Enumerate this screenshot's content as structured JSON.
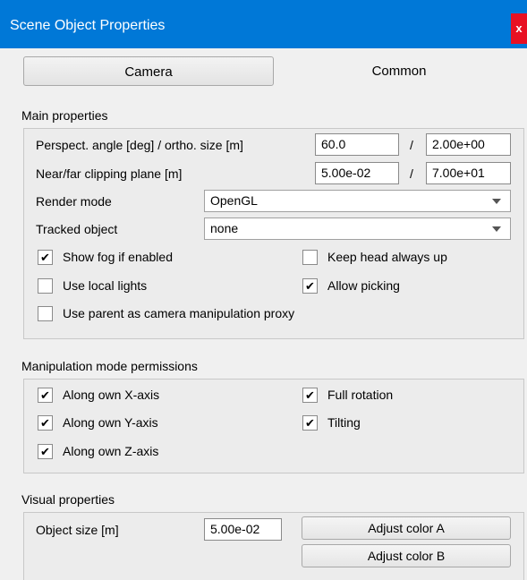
{
  "window": {
    "title": "Scene Object Properties",
    "close_label": "x"
  },
  "tabs": [
    {
      "label": "Camera",
      "active": true
    },
    {
      "label": "Common",
      "active": false
    }
  ],
  "main": {
    "section_label": "Main properties",
    "perspective": {
      "label": "Perspect. angle [deg] / ortho. size [m]",
      "value1": "60.0",
      "separator": "/",
      "value2": "2.00e+00"
    },
    "clipping": {
      "label": "Near/far clipping plane [m]",
      "value1": "5.00e-02",
      "separator": "/",
      "value2": "7.00e+01"
    },
    "render_mode": {
      "label": "Render mode",
      "value": "OpenGL"
    },
    "tracked_object": {
      "label": "Tracked object",
      "value": "none"
    },
    "checkboxes": {
      "show_fog": {
        "label": "Show fog if enabled",
        "checked": true
      },
      "keep_head_up": {
        "label": "Keep head always up",
        "checked": false
      },
      "use_local_lights": {
        "label": "Use local lights",
        "checked": false
      },
      "allow_picking": {
        "label": "Allow picking",
        "checked": true
      },
      "use_parent_proxy": {
        "label": "Use parent as camera manipulation proxy",
        "checked": false
      }
    }
  },
  "manipulation": {
    "section_label": "Manipulation mode permissions",
    "checkboxes": {
      "along_x": {
        "label": "Along own X-axis",
        "checked": true
      },
      "along_y": {
        "label": "Along own Y-axis",
        "checked": true
      },
      "along_z": {
        "label": "Along own Z-axis",
        "checked": true
      },
      "full_rotation": {
        "label": "Full rotation",
        "checked": true
      },
      "tilting": {
        "label": "Tilting",
        "checked": true
      }
    }
  },
  "visual": {
    "section_label": "Visual properties",
    "object_size": {
      "label": "Object size [m]",
      "value": "5.00e-02"
    },
    "adjust_color_a": "Adjust color A",
    "adjust_color_b": "Adjust color B"
  },
  "check_mark": "✔"
}
